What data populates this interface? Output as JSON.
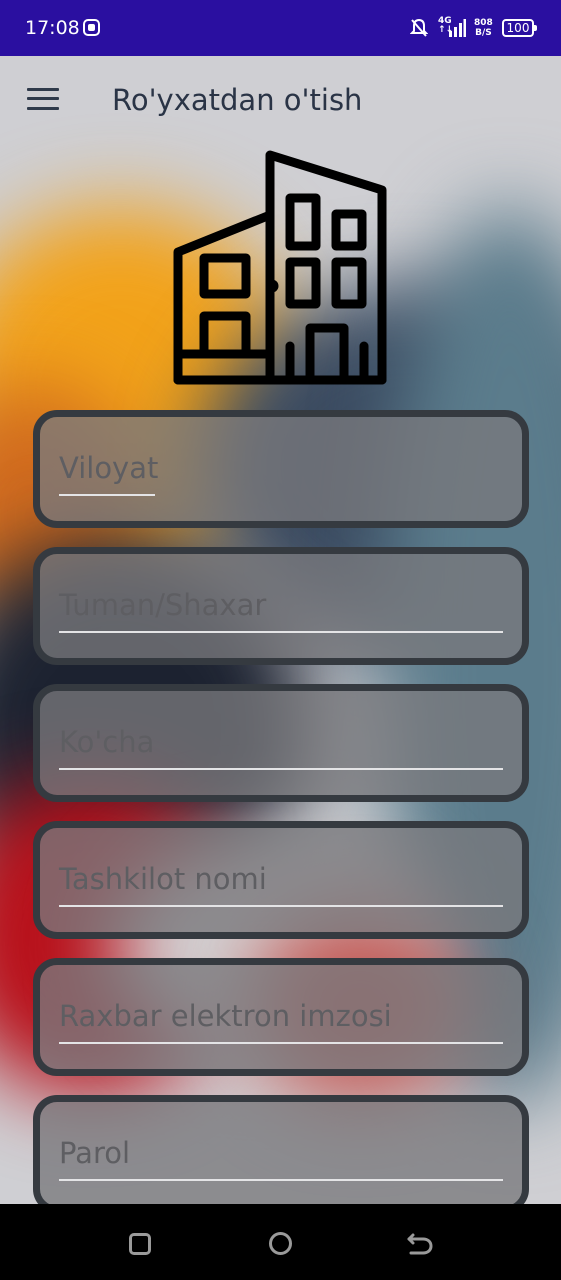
{
  "status_bar": {
    "time": "17:08",
    "network": "4G",
    "speed_value": "808",
    "speed_unit": "B/S",
    "battery": "100"
  },
  "app_bar": {
    "title": "Ro'yxatdan o'tish",
    "menu_icon": "hamburger-menu-icon"
  },
  "header_icon": "building-icon",
  "form": {
    "fields": [
      {
        "placeholder": "Viloyat",
        "value": ""
      },
      {
        "placeholder": "Tuman/Shaxar",
        "value": ""
      },
      {
        "placeholder": "Ko'cha",
        "value": ""
      },
      {
        "placeholder": "Tashkilot nomi",
        "value": ""
      },
      {
        "placeholder": "Raxbar elektron imzosi",
        "value": ""
      },
      {
        "placeholder": "Parol",
        "value": ""
      }
    ]
  },
  "nav_bar": {
    "icons": [
      "recents-icon",
      "home-icon",
      "back-icon"
    ]
  },
  "colors": {
    "status_bar": "#2a0fa0",
    "field_border": "#353a40",
    "title_text": "#2a3446"
  }
}
